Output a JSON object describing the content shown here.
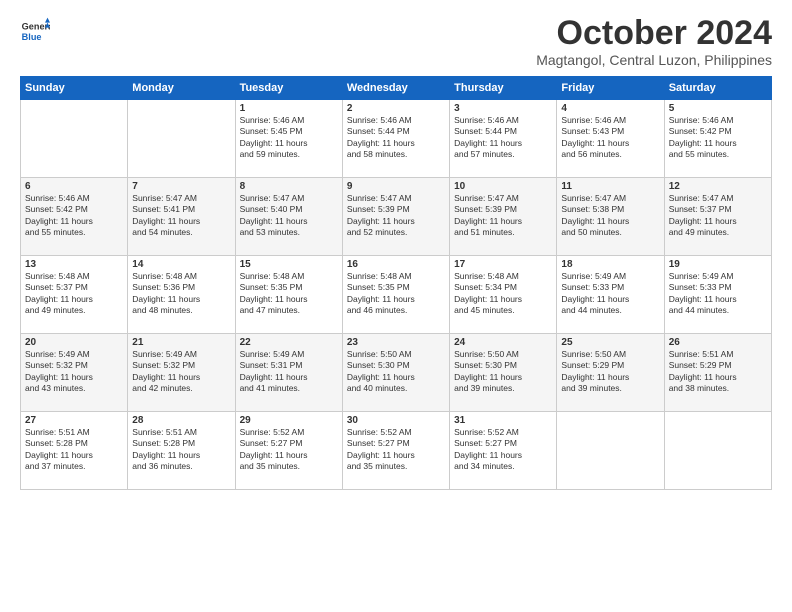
{
  "logo": {
    "line1": "General",
    "line2": "Blue"
  },
  "header": {
    "month": "October 2024",
    "location": "Magtangol, Central Luzon, Philippines"
  },
  "weekdays": [
    "Sunday",
    "Monday",
    "Tuesday",
    "Wednesday",
    "Thursday",
    "Friday",
    "Saturday"
  ],
  "weeks": [
    [
      {
        "day": "",
        "content": ""
      },
      {
        "day": "",
        "content": ""
      },
      {
        "day": "1",
        "content": "Sunrise: 5:46 AM\nSunset: 5:45 PM\nDaylight: 11 hours\nand 59 minutes."
      },
      {
        "day": "2",
        "content": "Sunrise: 5:46 AM\nSunset: 5:44 PM\nDaylight: 11 hours\nand 58 minutes."
      },
      {
        "day": "3",
        "content": "Sunrise: 5:46 AM\nSunset: 5:44 PM\nDaylight: 11 hours\nand 57 minutes."
      },
      {
        "day": "4",
        "content": "Sunrise: 5:46 AM\nSunset: 5:43 PM\nDaylight: 11 hours\nand 56 minutes."
      },
      {
        "day": "5",
        "content": "Sunrise: 5:46 AM\nSunset: 5:42 PM\nDaylight: 11 hours\nand 55 minutes."
      }
    ],
    [
      {
        "day": "6",
        "content": "Sunrise: 5:46 AM\nSunset: 5:42 PM\nDaylight: 11 hours\nand 55 minutes."
      },
      {
        "day": "7",
        "content": "Sunrise: 5:47 AM\nSunset: 5:41 PM\nDaylight: 11 hours\nand 54 minutes."
      },
      {
        "day": "8",
        "content": "Sunrise: 5:47 AM\nSunset: 5:40 PM\nDaylight: 11 hours\nand 53 minutes."
      },
      {
        "day": "9",
        "content": "Sunrise: 5:47 AM\nSunset: 5:39 PM\nDaylight: 11 hours\nand 52 minutes."
      },
      {
        "day": "10",
        "content": "Sunrise: 5:47 AM\nSunset: 5:39 PM\nDaylight: 11 hours\nand 51 minutes."
      },
      {
        "day": "11",
        "content": "Sunrise: 5:47 AM\nSunset: 5:38 PM\nDaylight: 11 hours\nand 50 minutes."
      },
      {
        "day": "12",
        "content": "Sunrise: 5:47 AM\nSunset: 5:37 PM\nDaylight: 11 hours\nand 49 minutes."
      }
    ],
    [
      {
        "day": "13",
        "content": "Sunrise: 5:48 AM\nSunset: 5:37 PM\nDaylight: 11 hours\nand 49 minutes."
      },
      {
        "day": "14",
        "content": "Sunrise: 5:48 AM\nSunset: 5:36 PM\nDaylight: 11 hours\nand 48 minutes."
      },
      {
        "day": "15",
        "content": "Sunrise: 5:48 AM\nSunset: 5:35 PM\nDaylight: 11 hours\nand 47 minutes."
      },
      {
        "day": "16",
        "content": "Sunrise: 5:48 AM\nSunset: 5:35 PM\nDaylight: 11 hours\nand 46 minutes."
      },
      {
        "day": "17",
        "content": "Sunrise: 5:48 AM\nSunset: 5:34 PM\nDaylight: 11 hours\nand 45 minutes."
      },
      {
        "day": "18",
        "content": "Sunrise: 5:49 AM\nSunset: 5:33 PM\nDaylight: 11 hours\nand 44 minutes."
      },
      {
        "day": "19",
        "content": "Sunrise: 5:49 AM\nSunset: 5:33 PM\nDaylight: 11 hours\nand 44 minutes."
      }
    ],
    [
      {
        "day": "20",
        "content": "Sunrise: 5:49 AM\nSunset: 5:32 PM\nDaylight: 11 hours\nand 43 minutes."
      },
      {
        "day": "21",
        "content": "Sunrise: 5:49 AM\nSunset: 5:32 PM\nDaylight: 11 hours\nand 42 minutes."
      },
      {
        "day": "22",
        "content": "Sunrise: 5:49 AM\nSunset: 5:31 PM\nDaylight: 11 hours\nand 41 minutes."
      },
      {
        "day": "23",
        "content": "Sunrise: 5:50 AM\nSunset: 5:30 PM\nDaylight: 11 hours\nand 40 minutes."
      },
      {
        "day": "24",
        "content": "Sunrise: 5:50 AM\nSunset: 5:30 PM\nDaylight: 11 hours\nand 39 minutes."
      },
      {
        "day": "25",
        "content": "Sunrise: 5:50 AM\nSunset: 5:29 PM\nDaylight: 11 hours\nand 39 minutes."
      },
      {
        "day": "26",
        "content": "Sunrise: 5:51 AM\nSunset: 5:29 PM\nDaylight: 11 hours\nand 38 minutes."
      }
    ],
    [
      {
        "day": "27",
        "content": "Sunrise: 5:51 AM\nSunset: 5:28 PM\nDaylight: 11 hours\nand 37 minutes."
      },
      {
        "day": "28",
        "content": "Sunrise: 5:51 AM\nSunset: 5:28 PM\nDaylight: 11 hours\nand 36 minutes."
      },
      {
        "day": "29",
        "content": "Sunrise: 5:52 AM\nSunset: 5:27 PM\nDaylight: 11 hours\nand 35 minutes."
      },
      {
        "day": "30",
        "content": "Sunrise: 5:52 AM\nSunset: 5:27 PM\nDaylight: 11 hours\nand 35 minutes."
      },
      {
        "day": "31",
        "content": "Sunrise: 5:52 AM\nSunset: 5:27 PM\nDaylight: 11 hours\nand 34 minutes."
      },
      {
        "day": "",
        "content": ""
      },
      {
        "day": "",
        "content": ""
      }
    ]
  ]
}
